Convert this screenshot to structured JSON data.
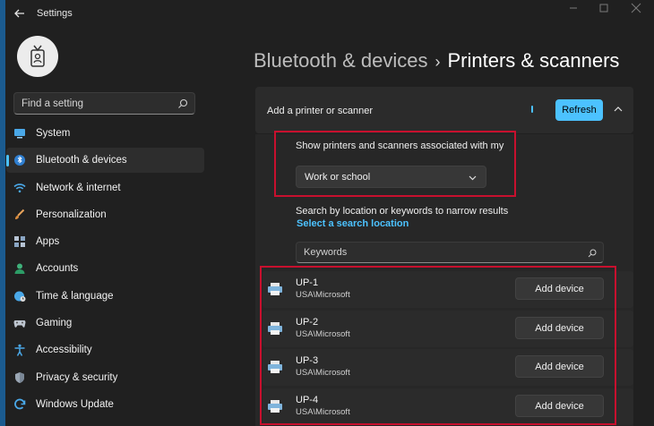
{
  "window": {
    "title": "Settings"
  },
  "search": {
    "placeholder": "Find a setting"
  },
  "sidebar": {
    "items": [
      {
        "label": "System",
        "icon": "monitor-icon",
        "active": false
      },
      {
        "label": "Bluetooth & devices",
        "icon": "bluetooth-icon",
        "active": true
      },
      {
        "label": "Network & internet",
        "icon": "wifi-icon",
        "active": false
      },
      {
        "label": "Personalization",
        "icon": "brush-icon",
        "active": false
      },
      {
        "label": "Apps",
        "icon": "apps-icon",
        "active": false
      },
      {
        "label": "Accounts",
        "icon": "person-icon",
        "active": false
      },
      {
        "label": "Time & language",
        "icon": "globe-clock-icon",
        "active": false
      },
      {
        "label": "Gaming",
        "icon": "gamepad-icon",
        "active": false
      },
      {
        "label": "Accessibility",
        "icon": "accessibility-icon",
        "active": false
      },
      {
        "label": "Privacy & security",
        "icon": "shield-icon",
        "active": false
      },
      {
        "label": "Windows Update",
        "icon": "update-icon",
        "active": false
      }
    ]
  },
  "breadcrumb": {
    "parent": "Bluetooth & devices",
    "separator": "›",
    "current": "Printers & scanners"
  },
  "add_panel": {
    "title": "Add a printer or scanner",
    "refresh_label": "Refresh",
    "association_label": "Show printers and scanners associated with my",
    "association_value": "Work or school",
    "narrow_label": "Search by location or keywords to narrow results",
    "location_link": "Select a search location",
    "keywords_placeholder": "Keywords"
  },
  "printers": [
    {
      "name": "UP-1",
      "location": "USA\\Microsoft",
      "button": "Add device"
    },
    {
      "name": "UP-2",
      "location": "USA\\Microsoft",
      "button": "Add device"
    },
    {
      "name": "UP-3",
      "location": "USA\\Microsoft",
      "button": "Add device"
    },
    {
      "name": "UP-4",
      "location": "USA\\Microsoft",
      "button": "Add device"
    }
  ],
  "colors": {
    "accent": "#4cc2ff",
    "highlight_border": "#c8102e",
    "background": "#202020"
  }
}
